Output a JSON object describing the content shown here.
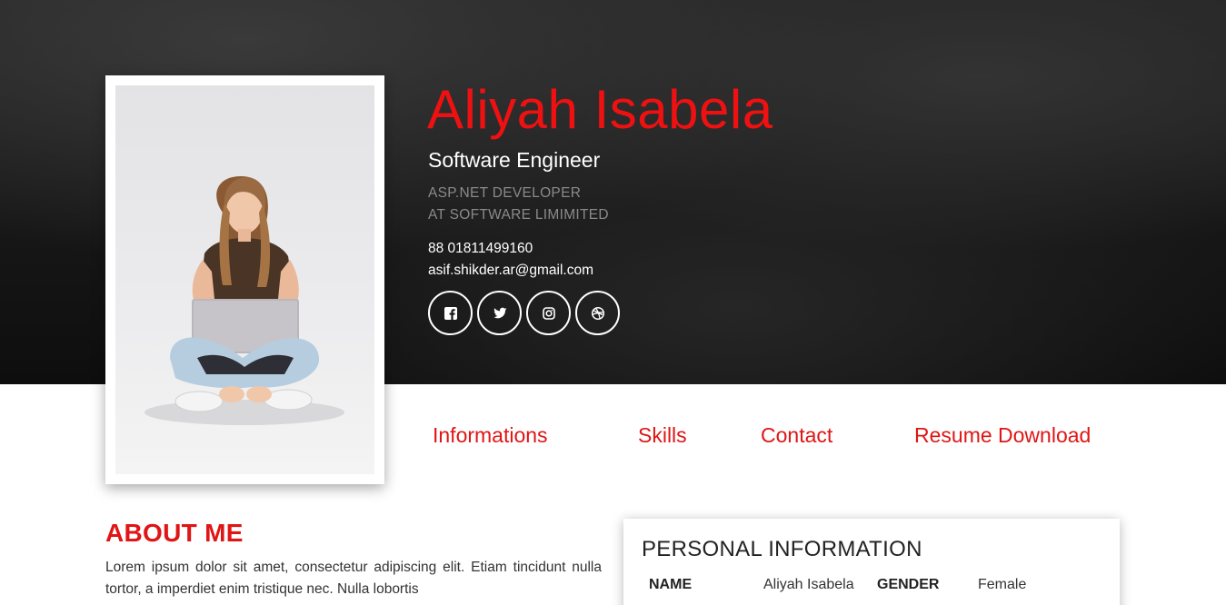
{
  "profile": {
    "name": "Aliyah Isabela",
    "title": "Software Engineer",
    "subtitle_line1": "ASP.NET DEVELOPER",
    "subtitle_line2": "AT SOFTWARE LIMIMITED",
    "phone": "88 01811499160",
    "email": "asif.shikder.ar@gmail.com"
  },
  "socials": [
    {
      "icon": "facebook-icon"
    },
    {
      "icon": "twitter-icon"
    },
    {
      "icon": "instagram-icon"
    },
    {
      "icon": "dribbble-icon"
    }
  ],
  "nav": {
    "items": [
      {
        "label": "Informations"
      },
      {
        "label": "Skills"
      },
      {
        "label": "Contact"
      },
      {
        "label": "Resume Download"
      }
    ]
  },
  "about": {
    "heading": "ABOUT ME",
    "text": "Lorem ipsum dolor sit amet, consectetur adipiscing elit. Etiam tincidunt nulla tortor, a imperdiet enim tristique nec. Nulla lobortis"
  },
  "personal_info": {
    "heading": "PERSONAL INFORMATION",
    "name_label": "NAME",
    "name_value": "Aliyah Isabela",
    "gender_label": "GENDER",
    "gender_value": "Female"
  },
  "colors": {
    "accent": "#ef1111",
    "hero_bg": "#151515",
    "text_dark": "#222222"
  }
}
